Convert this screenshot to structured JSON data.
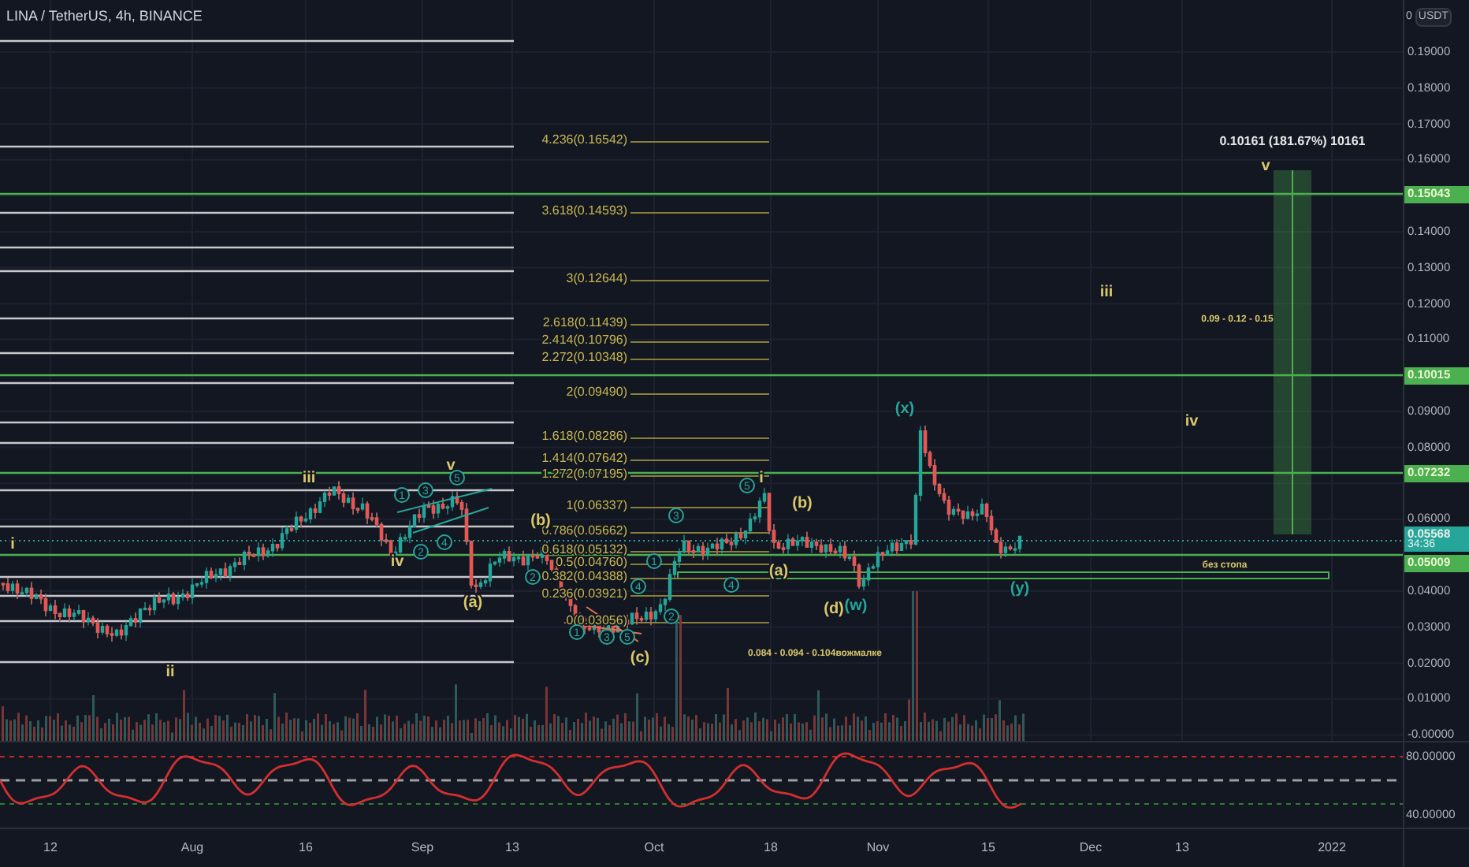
{
  "header": {
    "title": "LINA / TetherUS, 4h, BINANCE"
  },
  "price_axis": {
    "zero": "0",
    "currency": "USDT",
    "ticks": [
      "0.19000",
      "0.18000",
      "0.17000",
      "0.16000",
      "0.14000",
      "0.13000",
      "0.12000",
      "0.11000",
      "0.09000",
      "0.08000",
      "0.06000",
      "0.04000",
      "0.03000",
      "0.02000",
      "0.01000",
      "-0.00000"
    ]
  },
  "price_tags": [
    {
      "kind": "level",
      "label": "0.15043"
    },
    {
      "kind": "level",
      "label": "0.10015"
    },
    {
      "kind": "level",
      "label": "0.07232"
    },
    {
      "kind": "last",
      "label": "0.05568",
      "countdown": "34:36"
    },
    {
      "kind": "level",
      "label": "0.05009"
    }
  ],
  "fib_levels": [
    "4.236(0.16542)",
    "3.618(0.14593)",
    "3(0.12644)",
    "2.618(0.11439)",
    "2.414(0.10796)",
    "2.272(0.10348)",
    "2(0.09490)",
    "1.618(0.08286)",
    "1.414(0.07642)",
    "1.272(0.07195)",
    "1(0.06337)",
    "0.786(0.05662)",
    "0.618(0.05132)",
    "0.5(0.04760)",
    "0.382(0.04388)",
    "0.236(0.03921)",
    "0(0.03056)"
  ],
  "wave_labels": [
    {
      "text": "i",
      "kind": "plain",
      "color": "#d9c86a"
    },
    {
      "text": "ii",
      "kind": "plain",
      "color": "#d9c86a"
    },
    {
      "text": "iii",
      "kind": "plain",
      "color": "#d9c86a"
    },
    {
      "text": "iv",
      "kind": "plain",
      "color": "#d9c86a"
    },
    {
      "text": "v",
      "kind": "plain",
      "color": "#d9c86a"
    },
    {
      "text": "1",
      "kind": "circle",
      "color": "#26a69a"
    },
    {
      "text": "3",
      "kind": "circle",
      "color": "#26a69a"
    },
    {
      "text": "5",
      "kind": "circle",
      "color": "#26a69a"
    },
    {
      "text": "2",
      "kind": "circle",
      "color": "#26a69a"
    },
    {
      "text": "4",
      "kind": "circle",
      "color": "#26a69a"
    },
    {
      "text": "(a)",
      "kind": "plain",
      "color": "#d9c86a"
    },
    {
      "text": "(b)",
      "kind": "plain",
      "color": "#d9c86a"
    },
    {
      "text": "2",
      "kind": "circle",
      "color": "#26a69a"
    },
    {
      "text": "4",
      "kind": "circle",
      "color": "#26a69a"
    },
    {
      "text": "1",
      "kind": "circle",
      "color": "#26a69a"
    },
    {
      "text": "3",
      "kind": "circle",
      "color": "#26a69a"
    },
    {
      "text": "5",
      "kind": "circle",
      "color": "#26a69a"
    },
    {
      "text": "(c)",
      "kind": "plain",
      "color": "#d9c86a"
    },
    {
      "text": "1",
      "kind": "circle",
      "color": "#26a69a"
    },
    {
      "text": "2",
      "kind": "circle",
      "color": "#26a69a"
    },
    {
      "text": "3",
      "kind": "circle",
      "color": "#26a69a"
    },
    {
      "text": "4",
      "kind": "circle",
      "color": "#26a69a"
    },
    {
      "text": "5",
      "kind": "circle",
      "color": "#26a69a"
    },
    {
      "text": "i",
      "kind": "plain",
      "color": "#d9c86a"
    },
    {
      "text": "(b)",
      "kind": "plain",
      "color": "#d9c86a"
    },
    {
      "text": "(a)",
      "kind": "plain",
      "color": "#d9c86a"
    },
    {
      "text": "(d)",
      "kind": "plain",
      "color": "#d9c86a"
    },
    {
      "text": "(w)",
      "kind": "plain",
      "color": "#26a69a"
    },
    {
      "text": "(x)",
      "kind": "plain",
      "color": "#26a69a"
    },
    {
      "text": "(y)",
      "kind": "plain",
      "color": "#26a69a"
    },
    {
      "text": "iii",
      "kind": "plain",
      "color": "#d9c86a"
    },
    {
      "text": "iv",
      "kind": "plain",
      "color": "#d9c86a"
    },
    {
      "text": "v",
      "kind": "plain",
      "color": "#d9c86a"
    }
  ],
  "annotations": [
    {
      "kind": "measure",
      "text": "0.10161 (181.67%) 10161"
    },
    {
      "kind": "note",
      "text": "0.09 - 0.12 - 0.15"
    },
    {
      "kind": "note",
      "text": "без стопа"
    },
    {
      "kind": "note",
      "text": "0.084 - 0.094 - 0.104вожмалке"
    }
  ],
  "oscillator": {
    "ticks": [
      "80.00000",
      "40.00000"
    ]
  },
  "time_axis": {
    "labels": [
      "12",
      "Aug",
      "16",
      "Sep",
      "13",
      "Oct",
      "18",
      "Nov",
      "15",
      "Dec",
      "13",
      "2022"
    ]
  }
}
